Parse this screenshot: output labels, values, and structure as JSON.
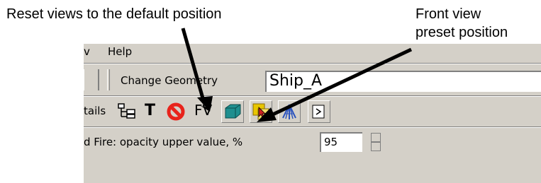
{
  "annotations": {
    "reset_views": "Reset views to the default position",
    "front_view_line1": "Front view",
    "front_view_line2": "preset position"
  },
  "menu": {
    "prev_partial": "v",
    "help": "Help"
  },
  "toolbar": {
    "change_geometry_label": "Change Geometry",
    "geometry_value": "Ship_A",
    "details_label": "tails",
    "text_tool_label": "T",
    "front_view_label": "FV"
  },
  "fire_panel": {
    "opacity_label": "d Fire:  opacity upper value, %",
    "opacity_value": "95"
  },
  "icons": {
    "tree": "tree-icon",
    "text": "text-tool-icon",
    "reset": "no-entry-icon",
    "box": "3d-box-icon",
    "select": "selection-icon",
    "fire": "fire-icon",
    "more": "more-icon"
  },
  "colors": {
    "toolbar_bg": "#d4d0c8",
    "reset_icon": "#e8231b",
    "box_icon": "#1f8f8f",
    "select_icon": "#e9c600",
    "fire_icon": "#2a52be"
  }
}
